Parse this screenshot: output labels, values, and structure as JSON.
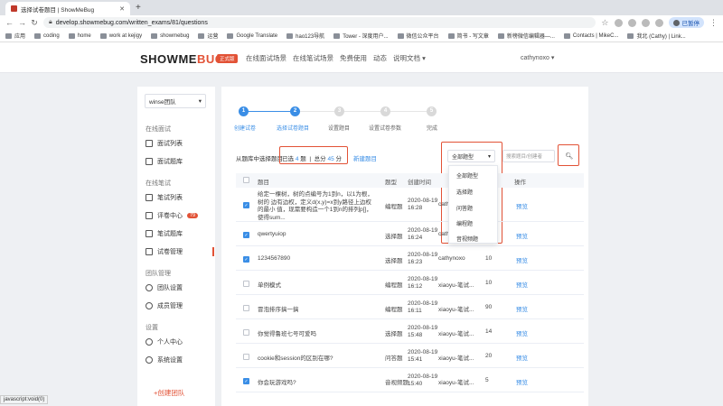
{
  "browser": {
    "tab_title": "选择试卷题目 | ShowMeBug",
    "url": "develop.showmebug.com/written_exams/81/questions",
    "paused_label": "已暂停"
  },
  "bookmarks": [
    "应用",
    "coding",
    "home",
    "work at kejigy",
    "showmebug",
    "运营",
    "Google Translate",
    "hao123导航",
    "Tower - 深度用户...",
    "微信公众平台",
    "简书 - 写文章",
    "新榜微信编辑器—...",
    "Contacts | MikeC...",
    "我北 (Cathy) | Link..."
  ],
  "header": {
    "logo_main": "SHOWME",
    "logo_accent": "BUG",
    "edition": "正式版",
    "nav": [
      "在线面试场景",
      "在线笔试场景",
      "免费使用",
      "动态",
      "说明文档 ▾"
    ],
    "user": "cathynoxo ▾"
  },
  "sidebar": {
    "team": "winse团队",
    "sections": {
      "interview": "在线面试",
      "written": "在线笔试",
      "team": "团队管理",
      "settings": "设置"
    },
    "items": {
      "interview_list": "面试列表",
      "interview_bank": "面试题库",
      "written_list": "笔试列表",
      "review_center": "评卷中心",
      "review_badge": "79",
      "written_bank": "笔试题库",
      "paper_manage": "试卷管理",
      "team_settings": "团队设置",
      "members": "成员管理",
      "profile": "个人中心",
      "system": "系统设置"
    },
    "create_team": "+创建团队"
  },
  "steps": [
    {
      "num": "1",
      "label": "创建试卷"
    },
    {
      "num": "2",
      "label": "选择试卷题目"
    },
    {
      "num": "3",
      "label": "设置题目"
    },
    {
      "num": "4",
      "label": "设置试卷参数"
    },
    {
      "num": "5",
      "label": "完成"
    }
  ],
  "filter": {
    "prefix": "从题库中选择题目",
    "selected_label": "已选",
    "selected_count": "4",
    "selected_unit": "题",
    "total_label": "总分",
    "total_score": "45",
    "total_unit": "分",
    "new_question": "新建题目",
    "type_value": "全部题型",
    "search_placeholder": "搜索题目/创建者"
  },
  "type_options": [
    "全部题型",
    "选择题",
    "问答题",
    "编程题",
    "音视频题"
  ],
  "table": {
    "headers": [
      "题目",
      "题型",
      "创建时间",
      "",
      "",
      "操作"
    ],
    "rows": [
      {
        "checked": true,
        "title": "给定一棵树，树的点编号为1到n，以1为根，树的 边有边权，定义d(x,y)=x到y路径上边权的最小 值，现需要构造一个1到n的排列p[]，使得sum...",
        "type": "编程题",
        "date": "2020-08-19",
        "time": "16:28",
        "creator": "cathy",
        "score": "",
        "action": "预览"
      },
      {
        "checked": true,
        "title": "qwertyuiop",
        "type": "选择题",
        "date": "2020-08-19",
        "time": "16:24",
        "creator": "cathy",
        "score": "",
        "action": "预览"
      },
      {
        "checked": true,
        "title": "1234567890",
        "type": "选择题",
        "date": "2020-08-19",
        "time": "16:23",
        "creator": "cathynoxo",
        "score": "10",
        "action": "预览"
      },
      {
        "checked": false,
        "title": "单例模式",
        "type": "编程题",
        "date": "2020-08-19",
        "time": "16:12",
        "creator": "xiaoyu-笔试...",
        "score": "10",
        "action": "预览"
      },
      {
        "checked": false,
        "title": "冒泡排序搞一搞",
        "type": "编程题",
        "date": "2020-08-19",
        "time": "16:11",
        "creator": "xiaoyu-笔试...",
        "score": "90",
        "action": "预览"
      },
      {
        "checked": false,
        "title": "你觉得鲁班七号可爱吗",
        "type": "选择题",
        "date": "2020-08-19",
        "time": "15:48",
        "creator": "xiaoyu-笔试...",
        "score": "14",
        "action": "预览"
      },
      {
        "checked": false,
        "title": "cookie和session的区别在哪?",
        "type": "问答题",
        "date": "2020-08-19",
        "time": "15:41",
        "creator": "xiaoyu-笔试...",
        "score": "20",
        "action": "预览"
      },
      {
        "checked": true,
        "title": "你会玩游戏吗?",
        "type": "音视频题",
        "date": "2020-08-19",
        "time": "15:40",
        "creator": "xiaoyu-笔试...",
        "score": "5",
        "action": "预览"
      }
    ]
  },
  "status_bar": "javascript:void(0)",
  "colors": {
    "accent": "#e25236",
    "primary": "#3a8ee6"
  }
}
